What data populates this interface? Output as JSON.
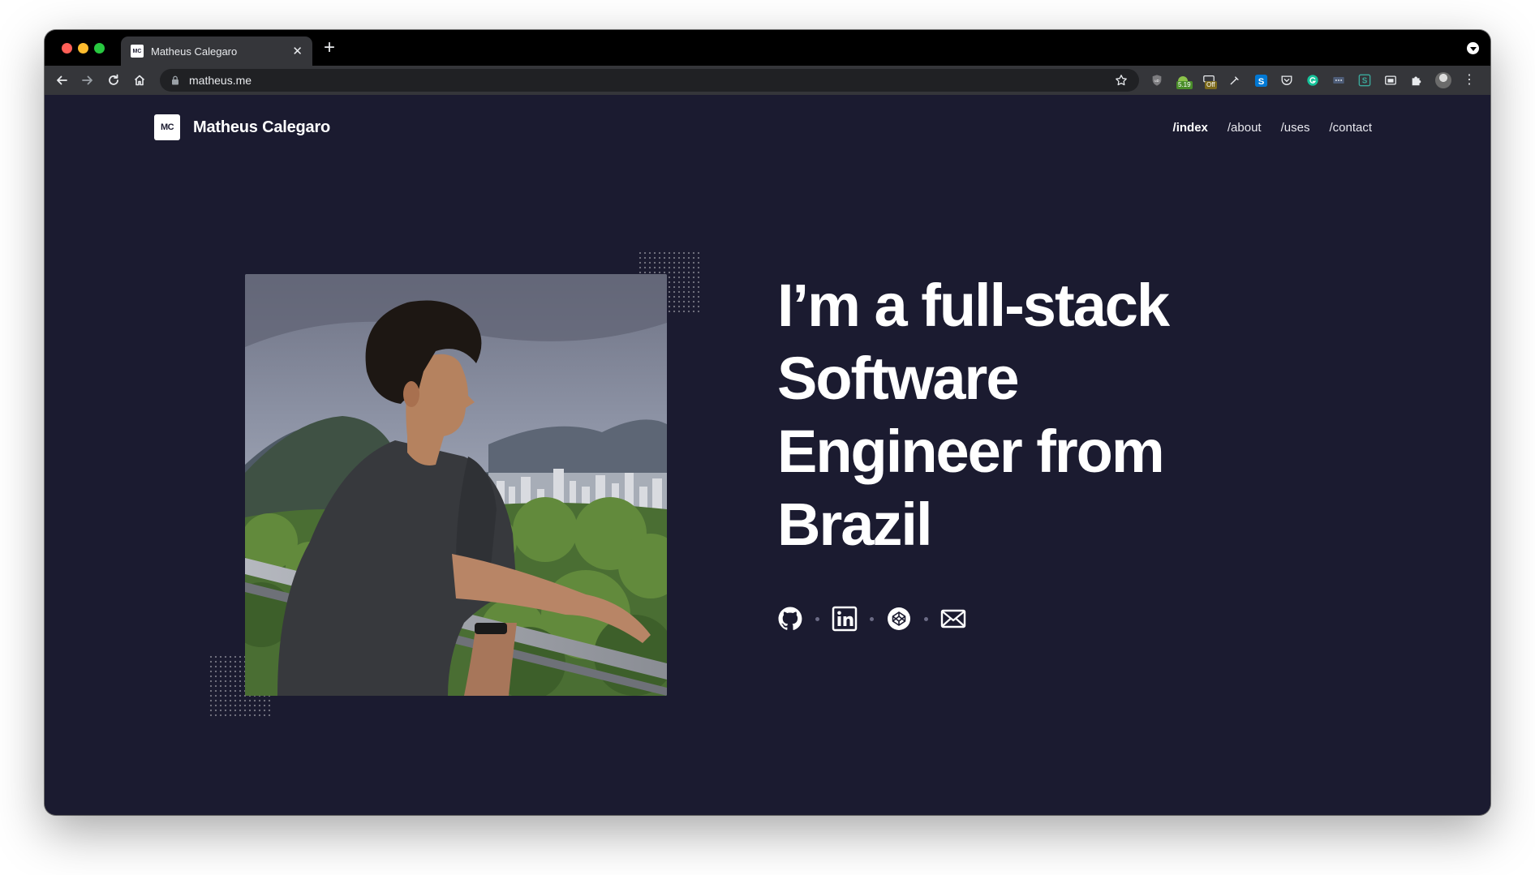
{
  "browser": {
    "tab_title": "Matheus Calegaro",
    "tab_favicon_text": "MC",
    "url": "matheus.me",
    "extension_badges": {
      "sales_badge": "5.19",
      "off_badge": "Off"
    }
  },
  "site": {
    "logo_text": "MC",
    "brand_name": "Matheus Calegaro",
    "nav": [
      "/index",
      "/about",
      "/uses",
      "/contact"
    ],
    "active_nav": "/index",
    "headline_lines": [
      "I’m a full-stack",
      "Software",
      "Engineer from",
      "Brazil"
    ],
    "socials": [
      "github-icon",
      "linkedin-icon",
      "codepen-icon",
      "email-icon"
    ]
  },
  "colors": {
    "page_background": "#1b1b30",
    "text": "#ffffff",
    "browser_chrome": "#35363a"
  }
}
